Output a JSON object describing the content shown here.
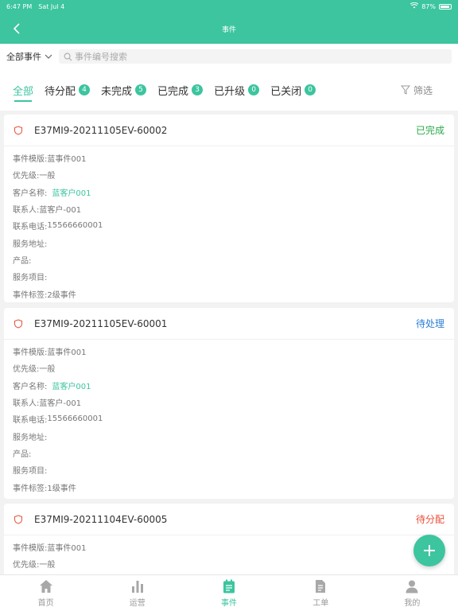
{
  "statusbar": {
    "time": "6:47 PM",
    "date": "Sat Jul 4",
    "battery": "87%"
  },
  "navbar": {
    "title": "事件"
  },
  "filterbar": {
    "dropdown": "全部事件",
    "search_placeholder": "事件编号搜索"
  },
  "tabs": [
    {
      "label": "全部",
      "badge": ""
    },
    {
      "label": "待分配",
      "badge": "4"
    },
    {
      "label": "未完成",
      "badge": "5"
    },
    {
      "label": "已完成",
      "badge": "3"
    },
    {
      "label": "已升级",
      "badge": "0"
    },
    {
      "label": "已关闭",
      "badge": "0"
    }
  ],
  "filter_label": "筛选",
  "colors": {
    "accent": "#3cc59f",
    "done": "#2aa84a",
    "pending": "#2b7fd6",
    "unassigned": "#e8503a"
  },
  "cards": [
    {
      "code": "E37MI9-20211105EV-60002",
      "status": "已完成",
      "fields": [
        {
          "label": "事件模版:",
          "value": "蓝事件001"
        },
        {
          "label": "优先级:",
          "value": "一般"
        },
        {
          "label": "客户名称:",
          "value": "蓝客户001"
        },
        {
          "label": "联系人:",
          "value": "蓝客户-001"
        },
        {
          "label": "联系电话:",
          "value": "15566660001"
        },
        {
          "label": "服务地址:",
          "value": ""
        },
        {
          "label": "产品:",
          "value": ""
        },
        {
          "label": "服务项目:",
          "value": ""
        },
        {
          "label": "事件标签:",
          "value": "2级事件"
        }
      ]
    },
    {
      "code": "E37MI9-20211105EV-60001",
      "status": "待处理",
      "fields": [
        {
          "label": "事件模版:",
          "value": "蓝事件001"
        },
        {
          "label": "优先级:",
          "value": "一般"
        },
        {
          "label": "客户名称:",
          "value": "蓝客户001"
        },
        {
          "label": "联系人:",
          "value": "蓝客户-001"
        },
        {
          "label": "联系电话:",
          "value": "15566660001"
        },
        {
          "label": "服务地址:",
          "value": ""
        },
        {
          "label": "产品:",
          "value": ""
        },
        {
          "label": "服务项目:",
          "value": ""
        },
        {
          "label": "事件标签:",
          "value": "1级事件"
        }
      ]
    },
    {
      "code": "E37MI9-20211104EV-60005",
      "status": "待分配",
      "fields": [
        {
          "label": "事件模版:",
          "value": "蓝事件001"
        },
        {
          "label": "优先级:",
          "value": "一般"
        }
      ]
    }
  ],
  "tabbar": [
    {
      "label": "首页",
      "icon": "home-icon"
    },
    {
      "label": "运营",
      "icon": "chart-icon"
    },
    {
      "label": "事件",
      "icon": "event-icon"
    },
    {
      "label": "工单",
      "icon": "document-icon"
    },
    {
      "label": "我的",
      "icon": "user-icon"
    }
  ]
}
